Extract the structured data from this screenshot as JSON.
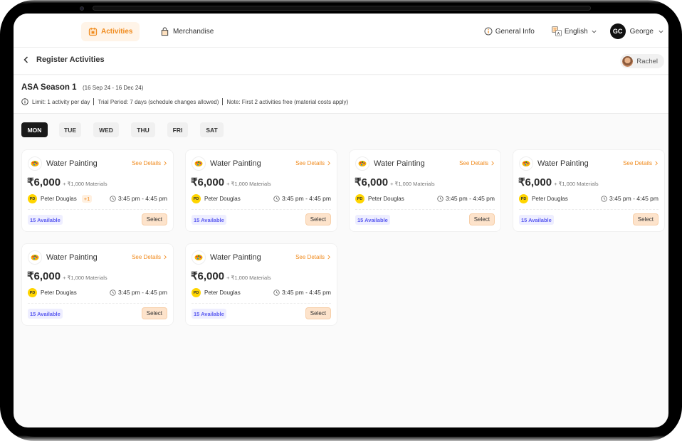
{
  "nav": {
    "tabs": [
      {
        "label": "Activities",
        "icon": "calendar-icon",
        "active": true
      },
      {
        "label": "Merchandise",
        "icon": "shopping-bag-icon",
        "active": false
      }
    ],
    "general_info": "General Info",
    "language": "English",
    "user": {
      "initials": "GC",
      "name": "George"
    }
  },
  "subheader": {
    "title": "Register Activities",
    "child_name": "Rachel"
  },
  "season": {
    "title": "ASA Season 1",
    "dates": "(16 Sep 24 - 16 Dec 24)",
    "notes": [
      "Limit: 1 activity per day",
      "Trial Period: 7 days (schedule changes allowed)",
      "Note: First 2 activities free (material costs apply)"
    ]
  },
  "days": [
    {
      "label": "MON",
      "active": true
    },
    {
      "label": "TUE",
      "active": false
    },
    {
      "label": "WED",
      "active": false
    },
    {
      "label": "THU",
      "active": false
    },
    {
      "label": "FRI",
      "active": false
    },
    {
      "label": "SAT",
      "active": false
    }
  ],
  "cards": [
    {
      "title": "Water Painting",
      "details_label": "See Details",
      "price": "₹6,000",
      "materials": "+ ₹1,000 Materials",
      "instructor_initials": "PD",
      "instructor": "Peter Douglas",
      "extra_instructors": "+1",
      "time": "3:45 pm - 4:45 pm",
      "available": "15 Available",
      "select_label": "Select"
    },
    {
      "title": "Water Painting",
      "details_label": "See Details",
      "price": "₹6,000",
      "materials": "+ ₹1,000 Materials",
      "instructor_initials": "PD",
      "instructor": "Peter Douglas",
      "extra_instructors": null,
      "time": "3:45 pm - 4:45 pm",
      "available": "15 Available",
      "select_label": "Select"
    },
    {
      "title": "Water Painting",
      "details_label": "See Details",
      "price": "₹6,000",
      "materials": "+ ₹1,000 Materials",
      "instructor_initials": "PD",
      "instructor": "Peter Douglas",
      "extra_instructors": null,
      "time": "3:45 pm - 4:45 pm",
      "available": "15 Available",
      "select_label": "Select"
    },
    {
      "title": "Water Painting",
      "details_label": "See Details",
      "price": "₹6,000",
      "materials": "+ ₹1,000 Materials",
      "instructor_initials": "PD",
      "instructor": "Peter Douglas",
      "extra_instructors": null,
      "time": "3:45 pm - 4:45 pm",
      "available": "15 Available",
      "select_label": "Select"
    },
    {
      "title": "Water Painting",
      "details_label": "See Details",
      "price": "₹6,000",
      "materials": "+ ₹1,000 Materials",
      "instructor_initials": "PD",
      "instructor": "Peter Douglas",
      "extra_instructors": null,
      "time": "3:45 pm - 4:45 pm",
      "available": "15 Available",
      "select_label": "Select"
    },
    {
      "title": "Water Painting",
      "details_label": "See Details",
      "price": "₹6,000",
      "materials": "+ ₹1,000 Materials",
      "instructor_initials": "PD",
      "instructor": "Peter Douglas",
      "extra_instructors": null,
      "time": "3:45 pm - 4:45 pm",
      "available": "15 Available",
      "select_label": "Select"
    }
  ],
  "colors": {
    "accent": "#f08a1c",
    "accent_bg": "#fff4e8",
    "available_text": "#5b5bf0",
    "available_bg": "#eeeeff",
    "select_bg": "#fde3cb",
    "instructor_badge": "#ffd500",
    "active_day_bg": "#1a1a1a"
  }
}
